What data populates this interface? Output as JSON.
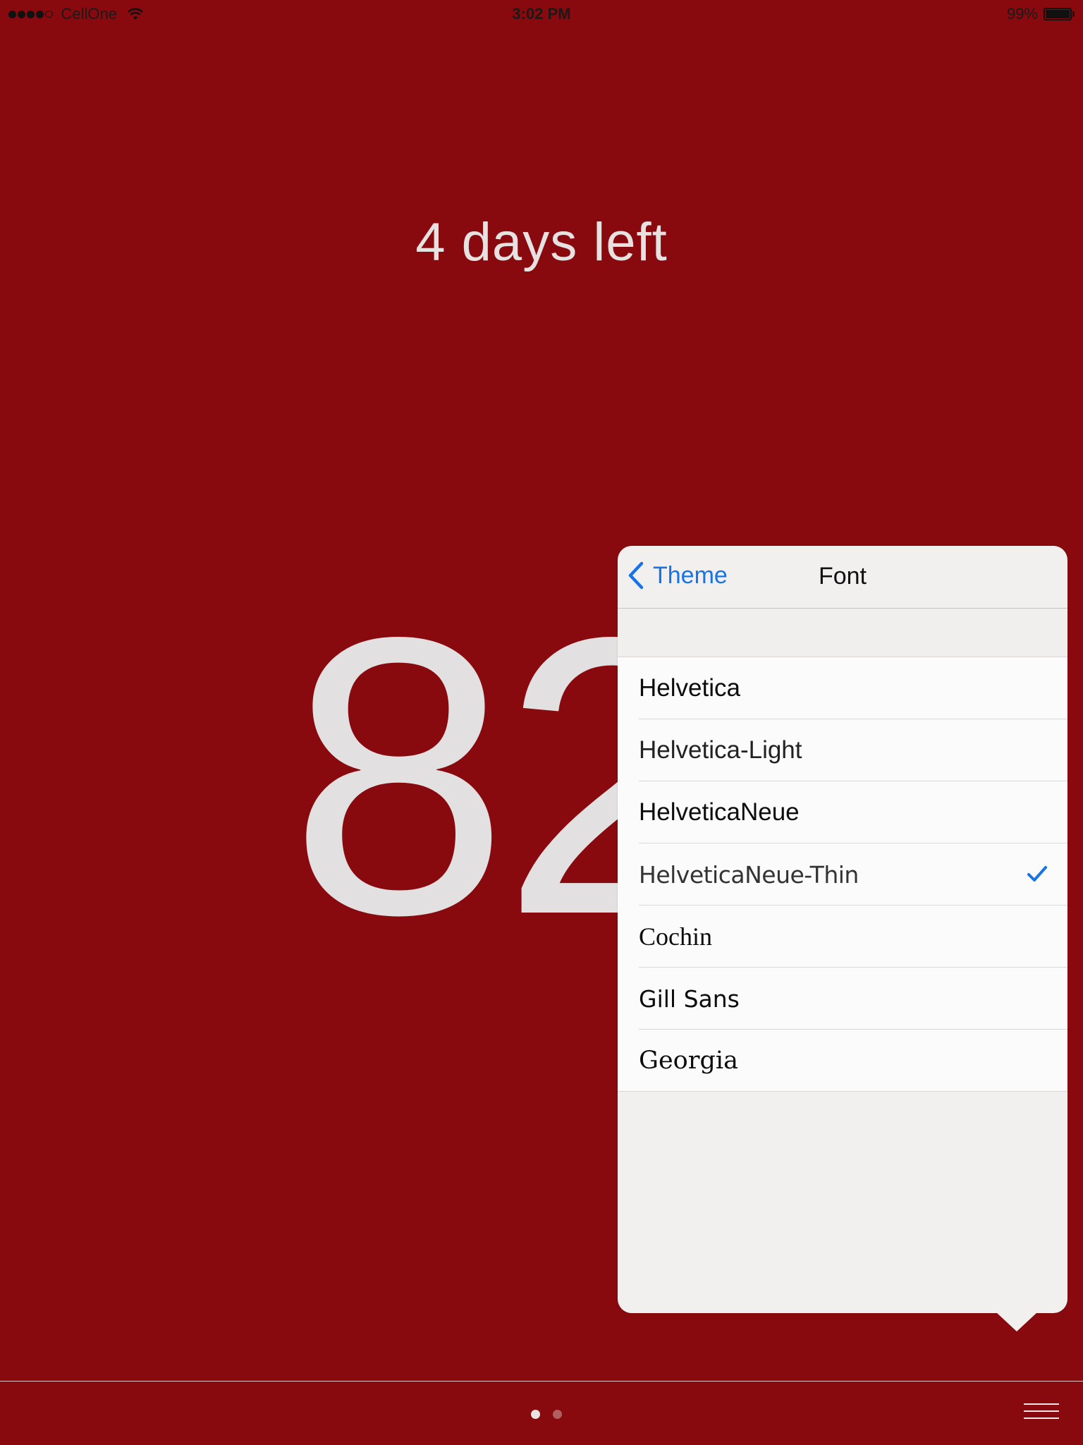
{
  "status_bar": {
    "carrier": "CellOne",
    "signal_bars": 4,
    "signal_total": 5,
    "time": "3:02 PM",
    "battery": "99%",
    "battery_level": 0.99
  },
  "main": {
    "days_left": "4 days left",
    "percentage": "82",
    "percent_sign": "%"
  },
  "popover": {
    "back_label": "Theme",
    "title": "Font",
    "fonts": [
      {
        "label": "Helvetica",
        "selected": false
      },
      {
        "label": "Helvetica-Light",
        "selected": false
      },
      {
        "label": "HelveticaNeue",
        "selected": false
      },
      {
        "label": "HelveticaNeue-Thin",
        "selected": true
      },
      {
        "label": "Cochin",
        "selected": false
      },
      {
        "label": "Gill Sans",
        "selected": false
      },
      {
        "label": "Georgia",
        "selected": false
      }
    ]
  },
  "bottom_bar": {
    "pages": 2,
    "current_page": 1
  },
  "colors": {
    "background": "#880A0E",
    "accent": "#1874E6",
    "popover_bg": "#F2EFEF"
  },
  "icons": {
    "back": "chevron-left-icon",
    "check": "checkmark-icon",
    "menu": "hamburger-menu-icon",
    "wifi": "wifi-icon",
    "battery": "battery-icon"
  }
}
